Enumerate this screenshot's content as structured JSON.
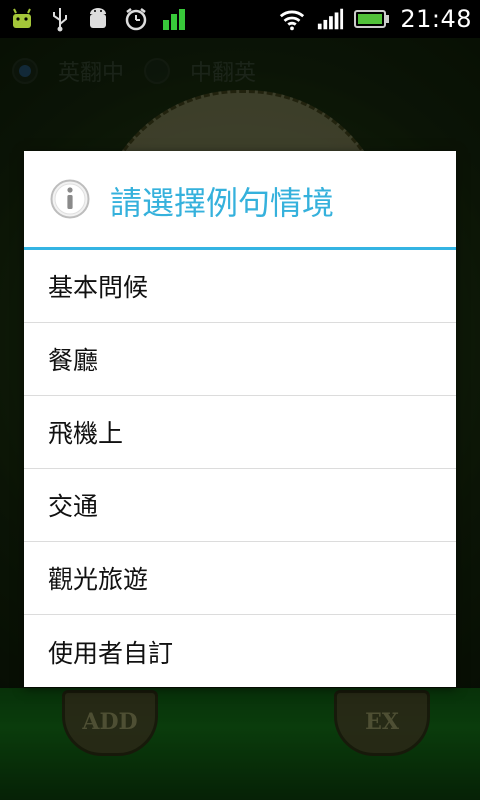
{
  "status_bar": {
    "time": "21:48",
    "icons": [
      "android-debug-icon",
      "usb-icon",
      "android-icon",
      "alarm-icon",
      "signal-bars-app-icon",
      "wifi-icon",
      "cell-signal-icon",
      "battery-icon"
    ]
  },
  "background": {
    "radio_options": [
      {
        "label": "英翻中",
        "checked": true
      },
      {
        "label": "中翻英",
        "checked": false
      }
    ],
    "basket_left_label": "ADD",
    "basket_right_label": "EX"
  },
  "dialog": {
    "title": "請選擇例句情境",
    "options": [
      "基本問候",
      "餐廳",
      "飛機上",
      "交通",
      "觀光旅遊",
      "使用者自訂"
    ]
  },
  "colors": {
    "accent": "#35b1dc",
    "divider": "#34b4e3"
  }
}
